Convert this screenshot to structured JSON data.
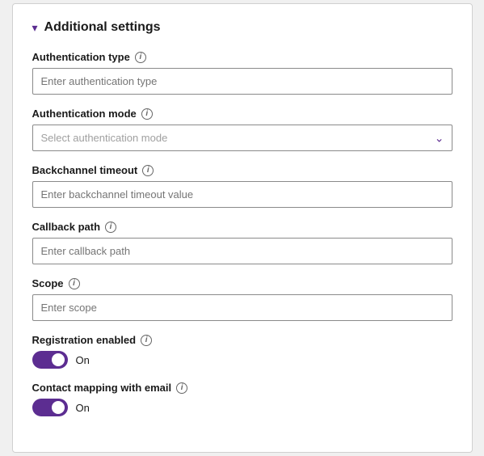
{
  "section": {
    "title": "Additional settings",
    "chevron": "▾"
  },
  "fields": {
    "auth_type": {
      "label": "Authentication type",
      "placeholder": "Enter authentication type"
    },
    "auth_mode": {
      "label": "Authentication mode",
      "placeholder": "Select authentication mode"
    },
    "backchannel_timeout": {
      "label": "Backchannel timeout",
      "placeholder": "Enter backchannel timeout value"
    },
    "callback_path": {
      "label": "Callback path",
      "placeholder": "Enter callback path"
    },
    "scope": {
      "label": "Scope",
      "placeholder": "Enter scope"
    },
    "registration_enabled": {
      "label": "Registration enabled",
      "toggle_label": "On"
    },
    "contact_mapping": {
      "label": "Contact mapping with email",
      "toggle_label": "On"
    }
  }
}
